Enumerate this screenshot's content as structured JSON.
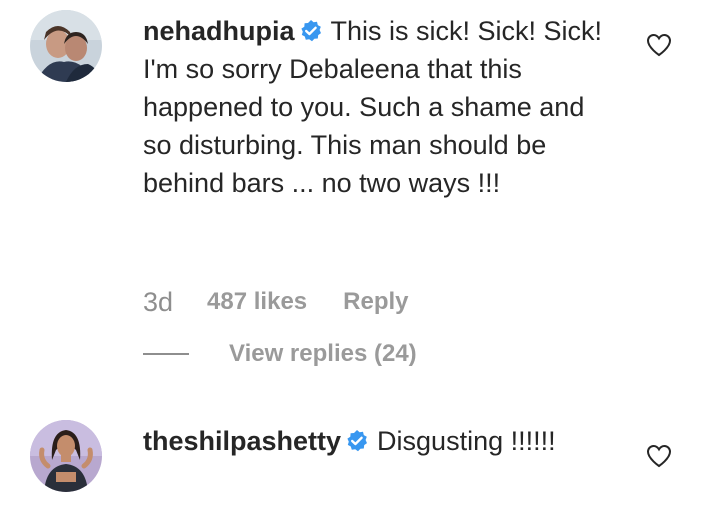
{
  "comments": [
    {
      "username": "nehadhupia",
      "verified_icon": "verified-badge-icon",
      "text": "This is sick! Sick! Sick! I'm so sorry Debaleena that this happened to you. Such a shame and so disturbing. This man should be behind bars ... no two ways !!!",
      "time": "3d",
      "likes": "487 likes",
      "reply_label": "Reply",
      "view_replies_label": "View replies (24)",
      "like_icon": "heart-outline-icon"
    },
    {
      "username": "theshilpashetty",
      "verified_icon": "verified-badge-icon",
      "text": "Disgusting !!!!!!",
      "like_icon": "heart-outline-icon"
    }
  ],
  "colors": {
    "text": "#262626",
    "muted": "#8e8e8e",
    "verified": "#3897f0"
  }
}
